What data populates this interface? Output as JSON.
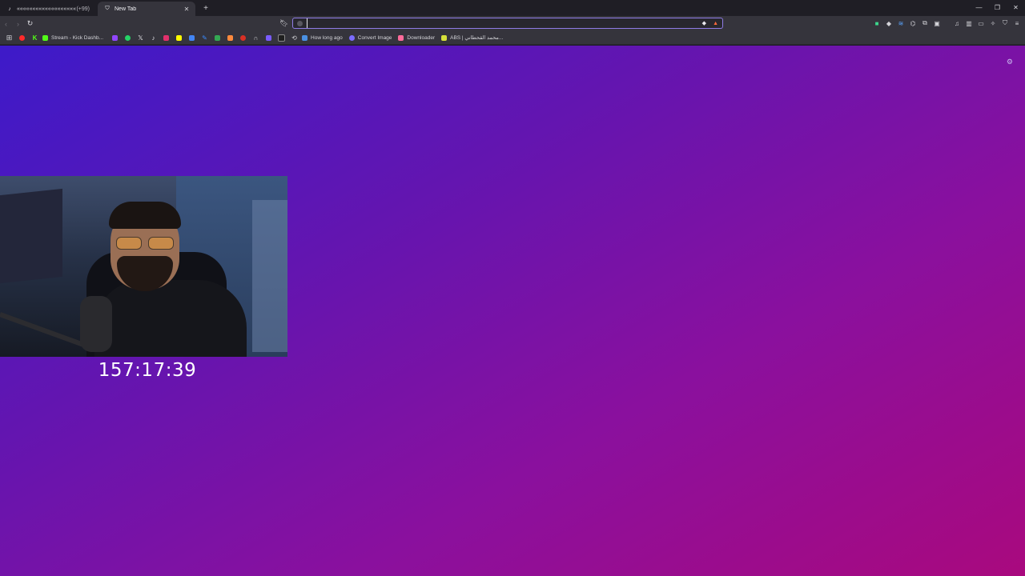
{
  "tabs": [
    {
      "title": "«««««««««««««««««««««««««««««««",
      "count": "(+99)",
      "favicon": "tiktok-icon",
      "active": false
    },
    {
      "title": "New Tab",
      "favicon": "shield-icon",
      "active": true
    }
  ],
  "toolbar": {
    "url_value": "",
    "url_placeholder": ""
  },
  "bookmarks": [
    {
      "label": "",
      "icon": "apps-icon",
      "color": "#cfcfd4"
    },
    {
      "label": "",
      "icon": "youtube-icon",
      "color": "#ff2a2a"
    },
    {
      "label": "",
      "icon": "kick-icon",
      "color": "#53fc18"
    },
    {
      "label": "Stream - Kick Dashb...",
      "icon": "kick-icon",
      "color": "#53fc18"
    },
    {
      "label": "",
      "icon": "twitch-icon",
      "color": "#9146ff"
    },
    {
      "label": "",
      "icon": "whatsapp-icon",
      "color": "#25d366"
    },
    {
      "label": "",
      "icon": "x-icon",
      "color": "#e8e8ec"
    },
    {
      "label": "",
      "icon": "tiktok-icon",
      "color": "#e8e8ec"
    },
    {
      "label": "",
      "icon": "instagram-icon",
      "color": "#e1306c"
    },
    {
      "label": "",
      "icon": "snapchat-icon",
      "color": "#fffc00"
    },
    {
      "label": "",
      "icon": "translate-icon",
      "color": "#4285f4"
    },
    {
      "label": "",
      "icon": "pen-icon",
      "color": "#3a8bff"
    },
    {
      "label": "",
      "icon": "chart-icon",
      "color": "#34a853"
    },
    {
      "label": "",
      "icon": "bag-icon",
      "color": "#ff8a3d"
    },
    {
      "label": "",
      "icon": "circle-icon",
      "color": "#d93025"
    },
    {
      "label": "",
      "icon": "headphones-icon",
      "color": "#cfcfd4"
    },
    {
      "label": "",
      "icon": "s-icon",
      "color": "#7a5cff"
    },
    {
      "label": "",
      "icon": "c-icon",
      "color": "#1f1f1f"
    },
    {
      "label": "",
      "icon": "link-icon",
      "color": "#cfcfd4"
    },
    {
      "label": "How long ago",
      "icon": "calendar-icon",
      "color": "#4a90e2"
    },
    {
      "label": "Convert Image",
      "icon": "convert-icon",
      "color": "#7b6cff"
    },
    {
      "label": "Downloader",
      "icon": "download-icon",
      "color": "#ff6b9a"
    },
    {
      "label": "ABS | محمد القحطاني...",
      "icon": "abs-icon",
      "color": "#d6e03a"
    }
  ],
  "page": {
    "timer": "157:17:39",
    "colors": {
      "gradient_start": "#3d1ac9",
      "gradient_mid": "#6315b0",
      "gradient_end": "#a9097e"
    }
  }
}
